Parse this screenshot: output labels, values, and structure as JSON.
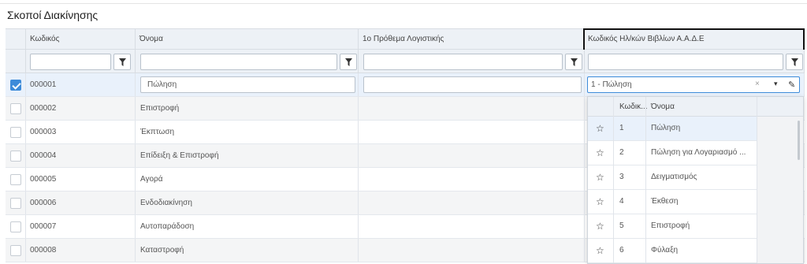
{
  "page_title": "Σκοποί Διακίνησης",
  "columns": [
    "Κωδικός",
    "Όνομα",
    "1ο Πρόθεμα Λογιστικής",
    "Κωδικός Ηλ/κών Βιβλίων Α.Α.Δ.Ε"
  ],
  "edit_row": {
    "code": "000001",
    "name": "Πώληση",
    "prefix": "",
    "aade_value": "1 - Πώληση",
    "clear_glyph": "×",
    "caret_glyph": "▾",
    "edit_glyph": "✎"
  },
  "rows": [
    {
      "code": "000002",
      "name": "Επιστροφή"
    },
    {
      "code": "000003",
      "name": "Έκπτωση"
    },
    {
      "code": "000004",
      "name": "Επίδειξη & Επιστροφή"
    },
    {
      "code": "000005",
      "name": "Αγορά"
    },
    {
      "code": "000006",
      "name": "Ενδοδιακίνηση"
    },
    {
      "code": "000007",
      "name": "Αυτοπαράδοση"
    },
    {
      "code": "000008",
      "name": "Καταστροφή"
    }
  ],
  "dropdown": {
    "headers": [
      "Κωδικ...",
      "Όνομα"
    ],
    "star_glyph": "☆",
    "items": [
      {
        "code": "1",
        "name": "Πώληση"
      },
      {
        "code": "2",
        "name": "Πώληση για Λογαριασμό ..."
      },
      {
        "code": "3",
        "name": "Δειγματισμός"
      },
      {
        "code": "4",
        "name": "Έκθεση"
      },
      {
        "code": "5",
        "name": "Επιστροφή"
      },
      {
        "code": "6",
        "name": "Φύλαξη"
      }
    ]
  },
  "colors": {
    "accent": "#3d8bd9",
    "header_bg": "#edf1f6",
    "selected_row": "#e9f1fb"
  }
}
